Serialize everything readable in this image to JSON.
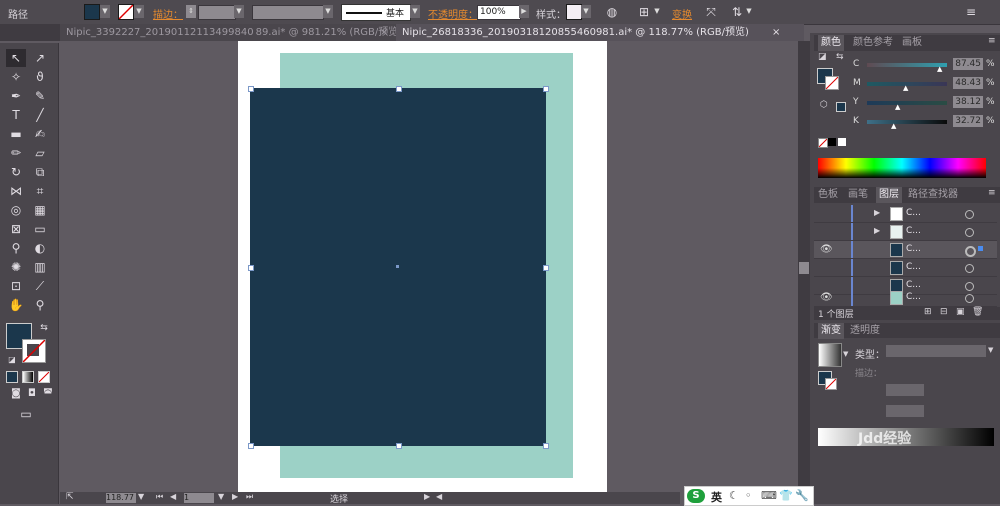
{
  "control_bar": {
    "path_label": "路径",
    "stroke_label": "描边：",
    "brush_label": "基本",
    "opacity_label": "不透明度：",
    "opacity_value": "100%",
    "style_label": "样式：",
    "transform_label": "变换",
    "fill_color": "#1b374c"
  },
  "tabs": [
    {
      "label": "Nipic_3392227_20190112113499840 89.ai* @ 981.21% (RGB/预览)",
      "close": "×"
    },
    {
      "label": "Nipic_26818336_20190318120855460981.ai* @ 118.77% (RGB/预览)",
      "close": "×"
    }
  ],
  "canvas": {
    "artboard_color": "#ffffff",
    "teal_color": "#9cd1c6",
    "navy_color": "#1b374c"
  },
  "status": {
    "zoom": "118.77",
    "page": "1",
    "selection_label": "选择"
  },
  "color_panel": {
    "tabs": [
      "颜色",
      "颜色参考",
      "画板"
    ],
    "channels": [
      {
        "label": "C",
        "value": "87.45",
        "pct": "%"
      },
      {
        "label": "M",
        "value": "48.43",
        "pct": "%"
      },
      {
        "label": "Y",
        "value": "38.12",
        "pct": "%"
      },
      {
        "label": "K",
        "value": "32.72",
        "pct": "%"
      }
    ],
    "channel_levels": [
      0.87,
      0.48,
      0.38,
      0.33
    ]
  },
  "layers_panel": {
    "tabs": [
      "色板",
      "画笔",
      "图层",
      "路径查找器"
    ],
    "rows": [
      {
        "name": "C...",
        "eye": false,
        "expand": true,
        "thumb": "#ffffff"
      },
      {
        "name": "C...",
        "eye": false,
        "expand": true,
        "thumb": "#e8f2f0"
      },
      {
        "name": "C...",
        "eye": true,
        "expand": false,
        "thumb": "#1b374c"
      },
      {
        "name": "C...",
        "eye": false,
        "expand": false,
        "thumb": "#1b374c"
      },
      {
        "name": "C...",
        "eye": false,
        "expand": false,
        "thumb": "#1b374c"
      },
      {
        "name": "C...",
        "eye": true,
        "expand": false,
        "thumb": "#9cd1c6"
      }
    ],
    "count_label": "1 个图层"
  },
  "gradient_panel": {
    "tabs": [
      "渐变",
      "透明度"
    ],
    "type_label": "类型：",
    "stroke_label": "描边："
  },
  "ime": {
    "logo": "S",
    "lang": "英"
  },
  "watermark": "Jdd经验"
}
